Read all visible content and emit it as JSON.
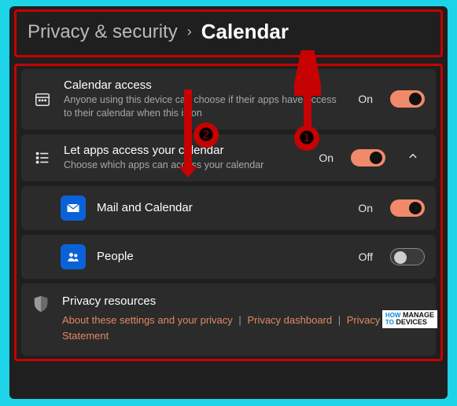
{
  "breadcrumb": {
    "parent": "Privacy & security",
    "current": "Calendar"
  },
  "rows": {
    "calendar_access": {
      "title": "Calendar access",
      "desc": "Anyone using this device can choose if their apps have access to their calendar when this is on",
      "state": "On"
    },
    "let_apps": {
      "title": "Let apps access your calendar",
      "desc": "Choose which apps can access your calendar",
      "state": "On"
    },
    "mail": {
      "title": "Mail and Calendar",
      "state": "On"
    },
    "people": {
      "title": "People",
      "state": "Off"
    }
  },
  "resources": {
    "title": "Privacy resources",
    "links": {
      "about": "About these settings and your privacy",
      "dashboard": "Privacy dashboard",
      "statement": "Privacy Statement"
    }
  },
  "annotations": {
    "n1": "❶",
    "n2": "❷"
  },
  "watermark": {
    "line1": "HOW",
    "line2": "TO",
    "brand1": "MANAGE",
    "brand2": "DEVICES"
  }
}
